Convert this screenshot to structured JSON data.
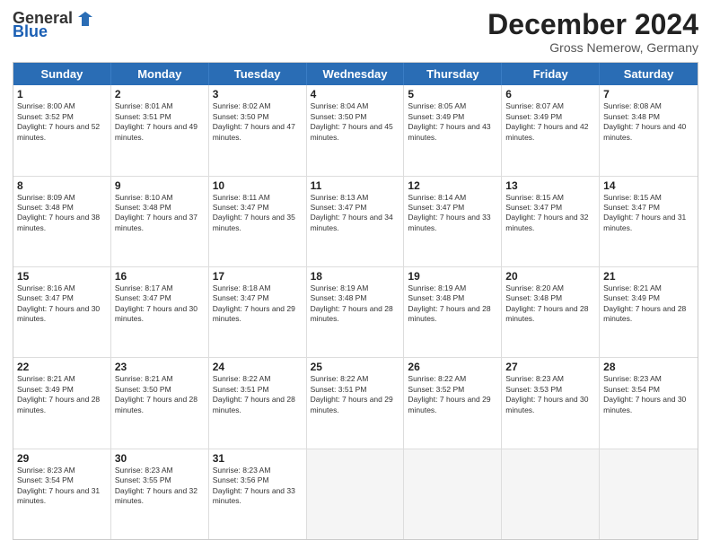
{
  "header": {
    "logo": {
      "general": "General",
      "blue": "Blue"
    },
    "title": "December 2024",
    "location": "Gross Nemerow, Germany"
  },
  "calendar": {
    "days_of_week": [
      "Sunday",
      "Monday",
      "Tuesday",
      "Wednesday",
      "Thursday",
      "Friday",
      "Saturday"
    ],
    "weeks": [
      [
        null,
        {
          "day": "2",
          "sunrise": "8:01 AM",
          "sunset": "3:51 PM",
          "daylight": "7 hours and 49 minutes."
        },
        {
          "day": "3",
          "sunrise": "8:02 AM",
          "sunset": "3:50 PM",
          "daylight": "7 hours and 47 minutes."
        },
        {
          "day": "4",
          "sunrise": "8:04 AM",
          "sunset": "3:50 PM",
          "daylight": "7 hours and 45 minutes."
        },
        {
          "day": "5",
          "sunrise": "8:05 AM",
          "sunset": "3:49 PM",
          "daylight": "7 hours and 43 minutes."
        },
        {
          "day": "6",
          "sunrise": "8:07 AM",
          "sunset": "3:49 PM",
          "daylight": "7 hours and 42 minutes."
        },
        {
          "day": "7",
          "sunrise": "8:08 AM",
          "sunset": "3:48 PM",
          "daylight": "7 hours and 40 minutes."
        }
      ],
      [
        {
          "day": "1",
          "sunrise": "8:00 AM",
          "sunset": "3:52 PM",
          "daylight": "7 hours and 52 minutes."
        },
        {
          "day": "9",
          "sunrise": "8:10 AM",
          "sunset": "3:48 PM",
          "daylight": "7 hours and 37 minutes."
        },
        {
          "day": "10",
          "sunrise": "8:11 AM",
          "sunset": "3:47 PM",
          "daylight": "7 hours and 35 minutes."
        },
        {
          "day": "11",
          "sunrise": "8:13 AM",
          "sunset": "3:47 PM",
          "daylight": "7 hours and 34 minutes."
        },
        {
          "day": "12",
          "sunrise": "8:14 AM",
          "sunset": "3:47 PM",
          "daylight": "7 hours and 33 minutes."
        },
        {
          "day": "13",
          "sunrise": "8:15 AM",
          "sunset": "3:47 PM",
          "daylight": "7 hours and 32 minutes."
        },
        {
          "day": "14",
          "sunrise": "8:15 AM",
          "sunset": "3:47 PM",
          "daylight": "7 hours and 31 minutes."
        }
      ],
      [
        {
          "day": "8",
          "sunrise": "8:09 AM",
          "sunset": "3:48 PM",
          "daylight": "7 hours and 38 minutes."
        },
        {
          "day": "16",
          "sunrise": "8:17 AM",
          "sunset": "3:47 PM",
          "daylight": "7 hours and 30 minutes."
        },
        {
          "day": "17",
          "sunrise": "8:18 AM",
          "sunset": "3:47 PM",
          "daylight": "7 hours and 29 minutes."
        },
        {
          "day": "18",
          "sunrise": "8:19 AM",
          "sunset": "3:48 PM",
          "daylight": "7 hours and 28 minutes."
        },
        {
          "day": "19",
          "sunrise": "8:19 AM",
          "sunset": "3:48 PM",
          "daylight": "7 hours and 28 minutes."
        },
        {
          "day": "20",
          "sunrise": "8:20 AM",
          "sunset": "3:48 PM",
          "daylight": "7 hours and 28 minutes."
        },
        {
          "day": "21",
          "sunrise": "8:21 AM",
          "sunset": "3:49 PM",
          "daylight": "7 hours and 28 minutes."
        }
      ],
      [
        {
          "day": "15",
          "sunrise": "8:16 AM",
          "sunset": "3:47 PM",
          "daylight": "7 hours and 30 minutes."
        },
        {
          "day": "23",
          "sunrise": "8:21 AM",
          "sunset": "3:50 PM",
          "daylight": "7 hours and 28 minutes."
        },
        {
          "day": "24",
          "sunrise": "8:22 AM",
          "sunset": "3:51 PM",
          "daylight": "7 hours and 28 minutes."
        },
        {
          "day": "25",
          "sunrise": "8:22 AM",
          "sunset": "3:51 PM",
          "daylight": "7 hours and 29 minutes."
        },
        {
          "day": "26",
          "sunrise": "8:22 AM",
          "sunset": "3:52 PM",
          "daylight": "7 hours and 29 minutes."
        },
        {
          "day": "27",
          "sunrise": "8:23 AM",
          "sunset": "3:53 PM",
          "daylight": "7 hours and 30 minutes."
        },
        {
          "day": "28",
          "sunrise": "8:23 AM",
          "sunset": "3:54 PM",
          "daylight": "7 hours and 30 minutes."
        }
      ],
      [
        {
          "day": "22",
          "sunrise": "8:21 AM",
          "sunset": "3:49 PM",
          "daylight": "7 hours and 28 minutes."
        },
        {
          "day": "30",
          "sunrise": "8:23 AM",
          "sunset": "3:55 PM",
          "daylight": "7 hours and 32 minutes."
        },
        {
          "day": "31",
          "sunrise": "8:23 AM",
          "sunset": "3:56 PM",
          "daylight": "7 hours and 33 minutes."
        },
        null,
        null,
        null,
        null
      ],
      [
        {
          "day": "29",
          "sunrise": "8:23 AM",
          "sunset": "3:54 PM",
          "daylight": "7 hours and 31 minutes."
        },
        null,
        null,
        null,
        null,
        null,
        null
      ]
    ],
    "week_day1": [
      {
        "day": "1",
        "sunrise": "8:00 AM",
        "sunset": "3:52 PM",
        "daylight": "7 hours and 52 minutes."
      }
    ]
  }
}
